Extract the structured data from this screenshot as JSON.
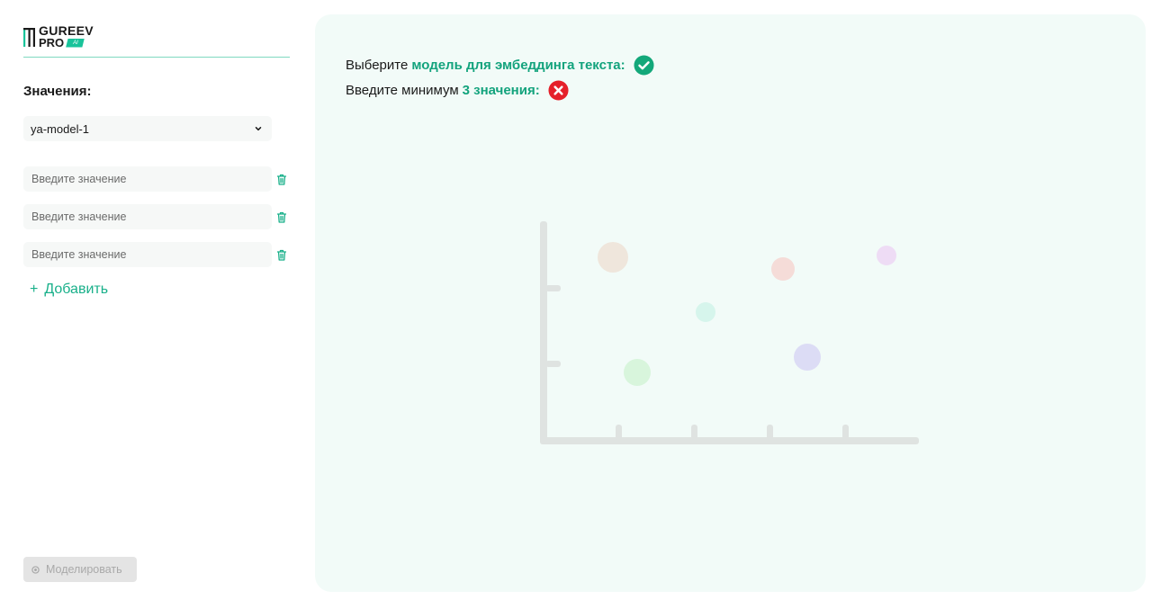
{
  "logo": {
    "line1": "GUREEV",
    "line2": "PRO",
    "badge": "AI"
  },
  "sidebar": {
    "section_title": "Значения:",
    "model_select": {
      "value": "ya-model-1"
    },
    "value_inputs": [
      {
        "placeholder": "Введите значение",
        "value": ""
      },
      {
        "placeholder": "Введите значение",
        "value": ""
      },
      {
        "placeholder": "Введите значение",
        "value": ""
      }
    ],
    "add_label": "Добавить",
    "add_icon": "plus-icon",
    "model_button": {
      "label": "Моделировать",
      "icon": "target-icon",
      "disabled": true
    }
  },
  "main": {
    "status": [
      {
        "prefix": "Выберите",
        "highlight": "модель для эмбеддинга текста:",
        "state": "ok",
        "icon": "check-circle-icon"
      },
      {
        "prefix": "Введите минимум",
        "highlight": "3 значения:",
        "state": "error",
        "icon": "x-circle-icon"
      }
    ],
    "placeholder_chart": {
      "icon": "scatter-plot-placeholder",
      "bubbles": [
        {
          "color": "#efe6dc"
        },
        {
          "color": "#f5dcd8"
        },
        {
          "color": "#eedcf5"
        },
        {
          "color": "#d6f5ec"
        },
        {
          "color": "#dcdcf5"
        },
        {
          "color": "#d8f5dc"
        }
      ]
    }
  },
  "colors": {
    "accent": "#19b08a",
    "panel_bg": "#f2fbf8",
    "ok": "#13a87a",
    "error": "#e5202a"
  }
}
